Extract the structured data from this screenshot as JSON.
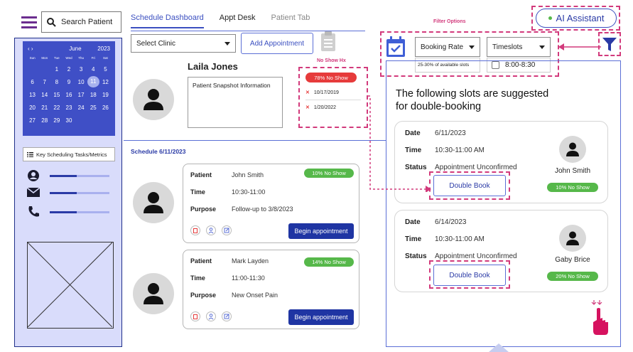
{
  "search": {
    "placeholder": "Search Patient"
  },
  "calendar": {
    "nav": "‹  ›",
    "month": "June",
    "year": "2023",
    "weekdays": [
      "Sun",
      "Mon",
      "Tue",
      "Wed",
      "Thu",
      "Fri",
      "Sat"
    ],
    "rows": [
      [
        "",
        "",
        "",
        "1",
        "2",
        "3",
        "4",
        "5"
      ],
      [
        "6",
        "7",
        "8",
        "9",
        "10",
        "11",
        "12"
      ],
      [
        "13",
        "14",
        "15",
        "16",
        "17",
        "18",
        "19"
      ],
      [
        "20",
        "21",
        "22",
        "23",
        "24",
        "25",
        "26"
      ],
      [
        "27",
        "28",
        "29",
        "30",
        "",
        "",
        ""
      ]
    ],
    "selected": "11"
  },
  "sidebar": {
    "key_tasks_label": "Key Scheduling Tasks/Metrics",
    "metrics": [
      {
        "icon": "user-icon",
        "fill": 0.45
      },
      {
        "icon": "mail-icon",
        "fill": 0.45
      },
      {
        "icon": "phone-icon",
        "fill": 0.45
      }
    ]
  },
  "tabs": {
    "dashboard": "Schedule Dashboard",
    "appt_desk": "Appt Desk",
    "patient_tab": "Patient Tab"
  },
  "toolbar": {
    "clinic_select": "Select Clinic",
    "add_appointment": "Add Appointment"
  },
  "patient": {
    "name": "Laila Jones",
    "snapshot": "Patient Snapshot Information",
    "no_show_title": "No Show Hx",
    "no_show_pct": "78% No Show",
    "no_show_dates": [
      "10/17/2019",
      "1/20/2022"
    ]
  },
  "schedule": {
    "title": "Schedule 6/11/2023",
    "labels": {
      "patient": "Patient",
      "time": "Time",
      "purpose": "Purpose"
    },
    "begin_label": "Begin appointment",
    "appointments": [
      {
        "patient": "John Smith",
        "time": "10:30-11:00",
        "purpose": "Follow-up to 3/8/2023",
        "no_show": "10% No Show"
      },
      {
        "patient": "Mark Layden",
        "time": "11:00-11:30",
        "purpose": "New Onset Pain",
        "no_show": "14% No Show"
      }
    ]
  },
  "ai": {
    "label": "AI Assistant",
    "status_color": "#56b84a"
  },
  "filters": {
    "title": "Filter Options",
    "booking_rate": "Booking Rate",
    "booking_rate_note": "25-30% of available slots",
    "timeslots": "Timeslots",
    "timeslot_option": "8:00-8:30"
  },
  "suggestions": {
    "heading": "The following slots are suggested for double-booking",
    "labels": {
      "date": "Date",
      "time": "Time",
      "status": "Status"
    },
    "double_book": "Double Book",
    "items": [
      {
        "date": "6/11/2023",
        "time": "10:30-11:00 AM",
        "status": "Appointment Unconfirmed",
        "name": "John Smith",
        "no_show": "10% No Show"
      },
      {
        "date": "6/14/2023",
        "time": "10:30-11:00 AM",
        "status": "Appointment Unconfirmed",
        "name": "Gaby Brice",
        "no_show": "20% No Show"
      }
    ]
  },
  "colors": {
    "accent": "#5b6fd6",
    "sidebar_bg": "#d9dcfb",
    "calendar_bg": "#3f4fc6",
    "annotation": "#d23a7c",
    "hamburger": "#6b2d8f",
    "calendar_icon": "#3f5fd6"
  }
}
